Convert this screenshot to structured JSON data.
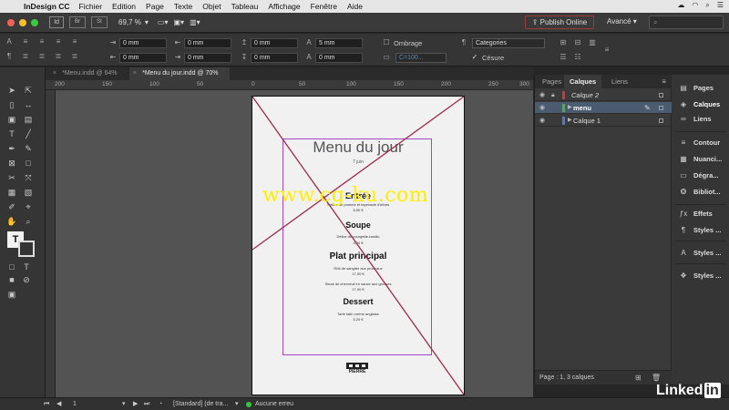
{
  "menubar": {
    "app_name": "InDesign CC",
    "items": [
      "Fichier",
      "Edition",
      "Page",
      "Texte",
      "Objet",
      "Tableau",
      "Affichage",
      "Fenêtre",
      "Aide"
    ]
  },
  "appbar": {
    "app_icon": "Id",
    "box1": "Br",
    "box2": "St",
    "zoom": "69,7 %",
    "publish_label": "Publish Online",
    "workspace_label": "Avancé"
  },
  "control": {
    "x": "0 mm",
    "y": "0 mm",
    "w": "0 mm",
    "h": "0 mm",
    "spacing1": "0 mm",
    "spacing2": "0 mm",
    "spacing3": "5 mm",
    "spacing4": "0 mm",
    "ombrage_label": "Ombrage",
    "style_value": "Categories",
    "cesure_label": "Césure",
    "color_value": "C=100..."
  },
  "tabs": [
    {
      "label": "*Menu.indd @ 64%"
    },
    {
      "label": "*Menu du jour.indd @ 70%"
    }
  ],
  "ruler": [
    "200",
    "150",
    "100",
    "50",
    "0",
    "50",
    "100",
    "150",
    "200",
    "250",
    "300"
  ],
  "page": {
    "title": "Menu du jour",
    "date": "7 juin",
    "sections": [
      {
        "name": "Entrée",
        "lines": [
          "Tartine de pomme et tapenade d'olives",
          "6,50 €"
        ]
      },
      {
        "name": "Soupe",
        "lines": [
          "Délice de courgette-basilic",
          "4,90 €"
        ]
      },
      {
        "name": "Plat principal",
        "lines": [
          "Rôti de sanglier aux pruneaux",
          "17,90 €",
          "Steak de chevreuil en sauce aux grosses",
          "17,90 €"
        ]
      },
      {
        "name": "Dessert",
        "lines": [
          "Tarte tatin crème anglaise",
          "5,20 €"
        ]
      }
    ],
    "logo_text": "PIERRE"
  },
  "watermark": "www.cg-ku.com",
  "layers_panel": {
    "tabs": [
      "Pages",
      "Calques",
      "Liens"
    ],
    "rows": [
      {
        "name": "Calque 2",
        "color": "#d8333a",
        "locked": true,
        "selected": false
      },
      {
        "name": "menu",
        "color": "#3cba3c",
        "locked": false,
        "selected": true
      },
      {
        "name": "Calque 1",
        "color": "#4a7bd8",
        "locked": false,
        "selected": false
      }
    ],
    "footer": "Page : 1, 3 calques"
  },
  "dock": [
    {
      "label": "Pages",
      "icon": "pages-icon",
      "glyph": "▤"
    },
    {
      "label": "Calques",
      "icon": "layers-icon",
      "glyph": "◈"
    },
    {
      "label": "Liens",
      "icon": "links-icon",
      "glyph": "∞"
    },
    {
      "label": "Contour",
      "icon": "stroke-icon",
      "glyph": "≡"
    },
    {
      "label": "Nuanci...",
      "icon": "swatches-icon",
      "glyph": "▦"
    },
    {
      "label": "Dégra...",
      "icon": "gradient-icon",
      "glyph": "▭"
    },
    {
      "label": "Bibliot...",
      "icon": "libraries-icon",
      "glyph": "❂"
    },
    {
      "label": "Effets",
      "icon": "effects-icon",
      "glyph": "ƒx"
    },
    {
      "label": "Styles ...",
      "icon": "paragraph-styles-icon",
      "glyph": "¶"
    },
    {
      "label": "Styles ...",
      "icon": "character-styles-icon",
      "glyph": "A"
    },
    {
      "label": "Styles ...",
      "icon": "object-styles-icon",
      "glyph": "❖"
    }
  ],
  "status": {
    "page": "1",
    "style": "[Standard] (de tra...",
    "preflight": "Aucune erreu"
  },
  "brand": {
    "text": "Linked",
    "in": "in"
  }
}
